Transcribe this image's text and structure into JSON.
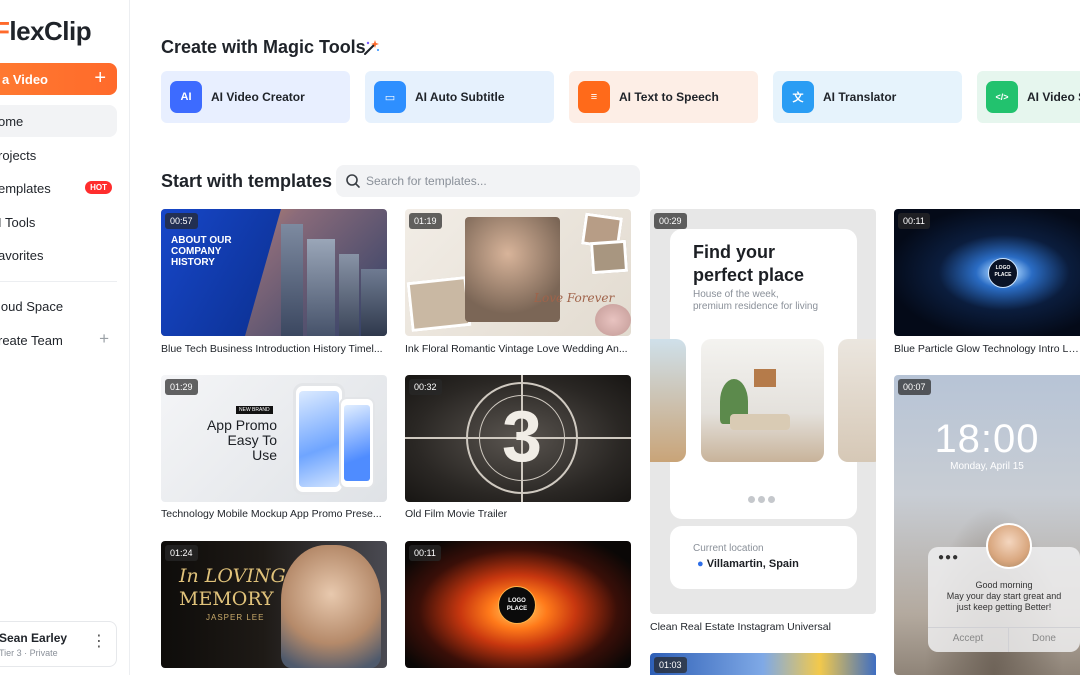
{
  "sidebar": {
    "logo_text": "lexClip",
    "logo_initial": "F",
    "new_button_label": "a Video",
    "items": [
      {
        "label": "ome",
        "active": true
      },
      {
        "label": "rojects"
      },
      {
        "label": "emplates",
        "badge": "HOT"
      },
      {
        "label": "I Tools"
      },
      {
        "label": "avorites"
      },
      {
        "label": "loud Space"
      },
      {
        "label": "reate Team"
      }
    ],
    "user": {
      "name": "Sean Earley",
      "meta": "Tier 3 · Private"
    }
  },
  "magic_tools": {
    "title": "Create with Magic Tools",
    "items": [
      {
        "label": "AI Video Creator",
        "icon": "ai-video-icon",
        "icon_text": "AI",
        "bg": "#e8efff",
        "accent": "#3d6bff"
      },
      {
        "label": "AI Auto Subtitle",
        "icon": "subtitle-icon",
        "icon_text": "▭",
        "bg": "#e6f1fd",
        "accent": "#2e8fff"
      },
      {
        "label": "AI Text to Speech",
        "icon": "speech-icon",
        "icon_text": "≡",
        "bg": "#fdeee6",
        "accent": "#ff6a1a"
      },
      {
        "label": "AI Translator",
        "icon": "translate-icon",
        "icon_text": "文",
        "bg": "#e6f3fc",
        "accent": "#2a9df4"
      },
      {
        "label": "AI Video S",
        "icon": "code-icon",
        "icon_text": "</>",
        "bg": "#e6f6ee",
        "accent": "#22c26e"
      }
    ]
  },
  "templates": {
    "title": "Start with templates",
    "search_placeholder": "Search for templates...",
    "cards": [
      {
        "duration": "00:57",
        "title": "Blue Tech Business Introduction History Timel...",
        "overlay": [
          "ABOUT OUR",
          "COMPANY",
          "HISTORY"
        ]
      },
      {
        "duration": "01:19",
        "title": "Ink Floral Romantic Vintage Love Wedding An...",
        "overlay": [
          "Love Forever"
        ]
      },
      {
        "duration": "00:29",
        "title": "Clean Real Estate Instagram Universal",
        "overlay": [
          "Find your",
          "perfect place",
          "House of the week,",
          "premium residence for living",
          "Current location",
          "Villamartin, Spain"
        ]
      },
      {
        "duration": "00:11",
        "title": "Blue Particle Glow Technology Intro Logo",
        "overlay": [
          "LOGO",
          "PLACE"
        ]
      },
      {
        "duration": "01:29",
        "title": "Technology Mobile Mockup App Promo Prese...",
        "overlay": [
          "NEW BRAND",
          "App Promo",
          "Easy To Use"
        ]
      },
      {
        "duration": "00:32",
        "title": "Old Film Movie Trailer",
        "overlay": [
          "3"
        ]
      },
      {
        "duration": "00:07",
        "title": "",
        "overlay": [
          "18:00",
          "Monday, April 15",
          "Good morning",
          "May your day start great and",
          "just keep getting Better!",
          "Accept",
          "Done"
        ]
      },
      {
        "duration": "01:24",
        "title": "",
        "overlay": [
          "In LOVING",
          "MEMORY",
          "JASPER LEE"
        ]
      },
      {
        "duration": "00:11",
        "title": "",
        "overlay": [
          "LOGO",
          "PLACE"
        ]
      },
      {
        "duration": "01:03",
        "title": "",
        "overlay": []
      }
    ]
  }
}
